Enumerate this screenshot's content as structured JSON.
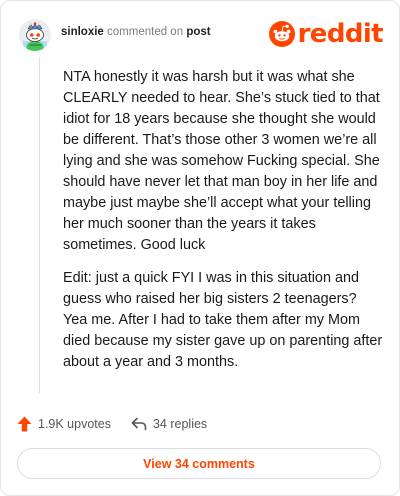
{
  "header": {
    "username": "sinloxie",
    "action_text": "commented on",
    "target_text": "post",
    "logo_text": "reddit"
  },
  "icons": {
    "avatar": "snoo-avatar-icon",
    "logo": "reddit-snoo-icon",
    "upvote": "upvote-arrow-icon",
    "reply": "reply-arrow-icon"
  },
  "colors": {
    "brand": "#ff4500",
    "text": "#1a1a1b",
    "muted": "#7c7c7c",
    "border": "#e4e4e4"
  },
  "comment": {
    "paragraphs": [
      "NTA honestly it was harsh but it was what she CLEARLY needed to hear. She’s stuck tied to that idiot for 18 years because she thought she would be different. That’s those other 3 women we’re all lying and she was somehow Fucking special. She should have never let that man boy in her life and maybe just maybe she’ll accept what your telling her much sooner than the years it takes sometimes. Good luck",
      "Edit: just a quick FYI I was in this situation and guess who raised her big sisters 2 teenagers? Yea me. After I had to take them after my Mom died because my sister gave up on parenting after about a year and 3 months."
    ]
  },
  "stats": {
    "upvotes": "1.9K upvotes",
    "replies": "34 replies"
  },
  "footer": {
    "view_label": "View 34 comments"
  }
}
